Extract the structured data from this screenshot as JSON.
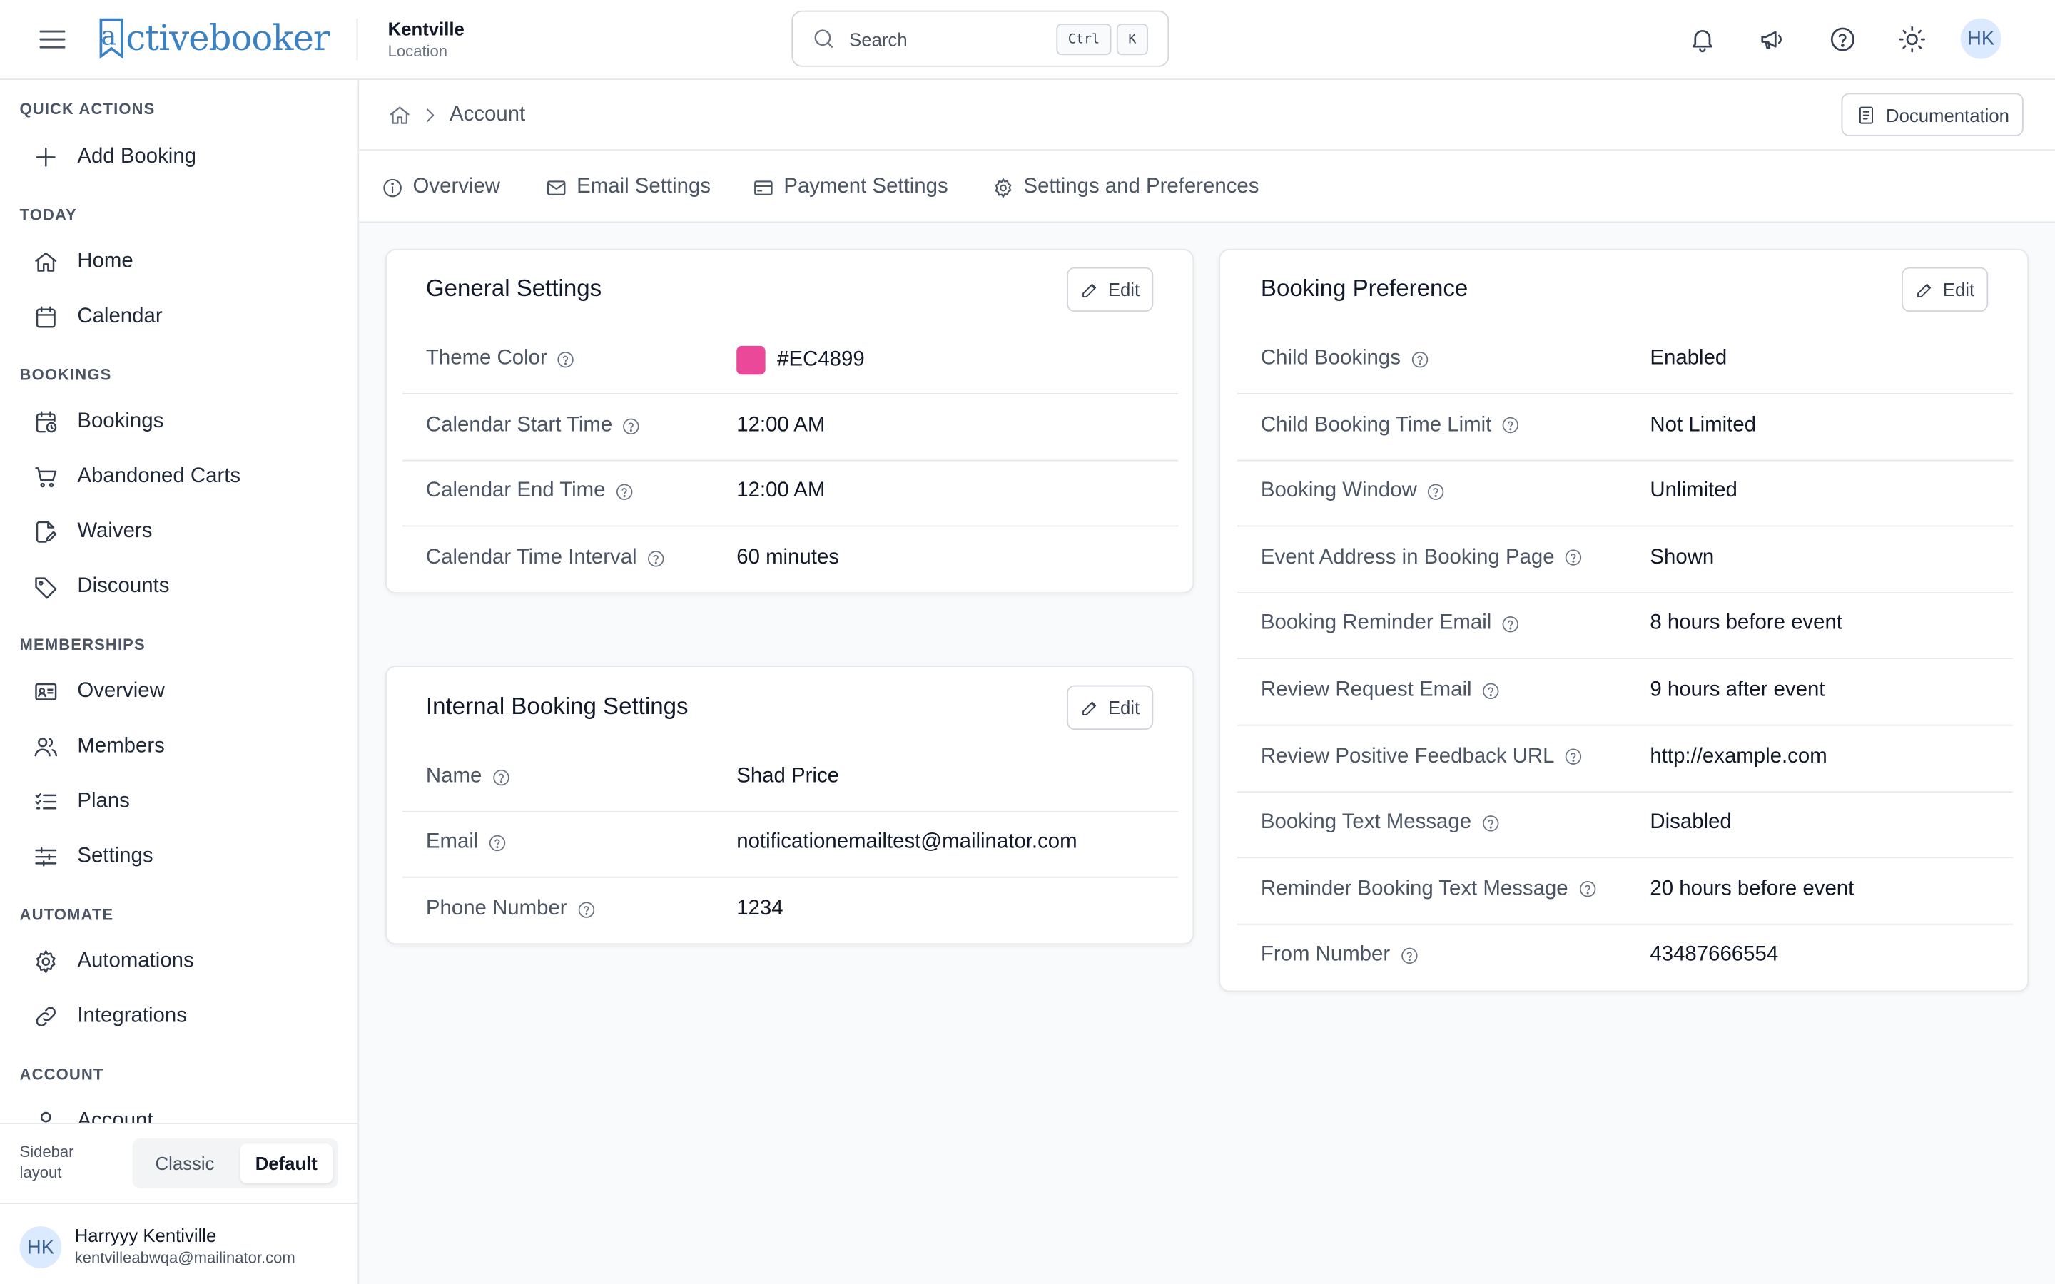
{
  "brand": {
    "name": "activebooker",
    "accent": "#3b82c4"
  },
  "location": {
    "name": "Kentville",
    "label": "Location"
  },
  "search": {
    "placeholder": "Search",
    "shortcut_ctrl": "Ctrl",
    "shortcut_key": "K"
  },
  "header": {
    "avatar_initials": "HK"
  },
  "sidebar": {
    "sections": [
      {
        "title": "QUICK ACTIONS",
        "items": [
          {
            "label": "Add Booking",
            "icon": "plus-icon"
          }
        ]
      },
      {
        "title": "TODAY",
        "items": [
          {
            "label": "Home",
            "icon": "home-icon"
          },
          {
            "label": "Calendar",
            "icon": "calendar-icon"
          }
        ]
      },
      {
        "title": "BOOKINGS",
        "items": [
          {
            "label": "Bookings",
            "icon": "calendar-clock-icon"
          },
          {
            "label": "Abandoned Carts",
            "icon": "cart-icon"
          },
          {
            "label": "Waivers",
            "icon": "file-signature-icon"
          },
          {
            "label": "Discounts",
            "icon": "tag-icon"
          }
        ]
      },
      {
        "title": "MEMBERSHIPS",
        "items": [
          {
            "label": "Overview",
            "icon": "id-card-icon"
          },
          {
            "label": "Members",
            "icon": "users-icon"
          },
          {
            "label": "Plans",
            "icon": "list-check-icon"
          },
          {
            "label": "Settings",
            "icon": "sliders-icon"
          }
        ]
      },
      {
        "title": "AUTOMATE",
        "items": [
          {
            "label": "Automations",
            "icon": "gear-icon"
          },
          {
            "label": "Integrations",
            "icon": "link-icon"
          }
        ]
      },
      {
        "title": "ACCOUNT",
        "items": [
          {
            "label": "Account",
            "icon": "user-icon"
          }
        ]
      }
    ],
    "layout_label": "Sidebar layout",
    "layout_options": {
      "classic": "Classic",
      "default": "Default"
    },
    "layout_selected": "Default",
    "user": {
      "initials": "HK",
      "name": "Harryyy Kentiville",
      "email": "kentvilleabwqa@mailinator.com"
    }
  },
  "breadcrumb": {
    "current": "Account"
  },
  "documentation_label": "Documentation",
  "tabs": [
    {
      "label": "Overview",
      "icon": "info-icon"
    },
    {
      "label": "Email Settings",
      "icon": "mail-icon"
    },
    {
      "label": "Payment Settings",
      "icon": "credit-card-icon"
    },
    {
      "label": "Settings and Preferences",
      "icon": "gear-icon"
    }
  ],
  "edit_label": "Edit",
  "general_settings": {
    "title": "General Settings",
    "rows": [
      {
        "label": "Theme Color",
        "value": "#EC4899",
        "swatch": "#EC4899"
      },
      {
        "label": "Calendar Start Time",
        "value": "12:00 AM"
      },
      {
        "label": "Calendar End Time",
        "value": "12:00 AM"
      },
      {
        "label": "Calendar Time Interval",
        "value": "60 minutes"
      }
    ]
  },
  "internal_booking_settings": {
    "title": "Internal Booking Settings",
    "rows": [
      {
        "label": "Name",
        "value": "Shad Price"
      },
      {
        "label": "Email",
        "value": "notificationemailtest@mailinator.com"
      },
      {
        "label": "Phone Number",
        "value": "1234"
      }
    ]
  },
  "booking_preference": {
    "title": "Booking Preference",
    "rows": [
      {
        "label": "Child Bookings",
        "value": "Enabled"
      },
      {
        "label": "Child Booking Time Limit",
        "value": "Not Limited"
      },
      {
        "label": "Booking Window",
        "value": "Unlimited"
      },
      {
        "label": "Event Address in Booking Page",
        "value": "Shown"
      },
      {
        "label": "Booking Reminder Email",
        "value": "8 hours before event"
      },
      {
        "label": "Review Request Email",
        "value": "9 hours after event"
      },
      {
        "label": "Review Positive Feedback URL",
        "value": "http://example.com"
      },
      {
        "label": "Booking Text Message",
        "value": "Disabled"
      },
      {
        "label": "Reminder Booking Text Message",
        "value": "20 hours before event"
      },
      {
        "label": "From Number",
        "value": "43487666554"
      }
    ]
  }
}
